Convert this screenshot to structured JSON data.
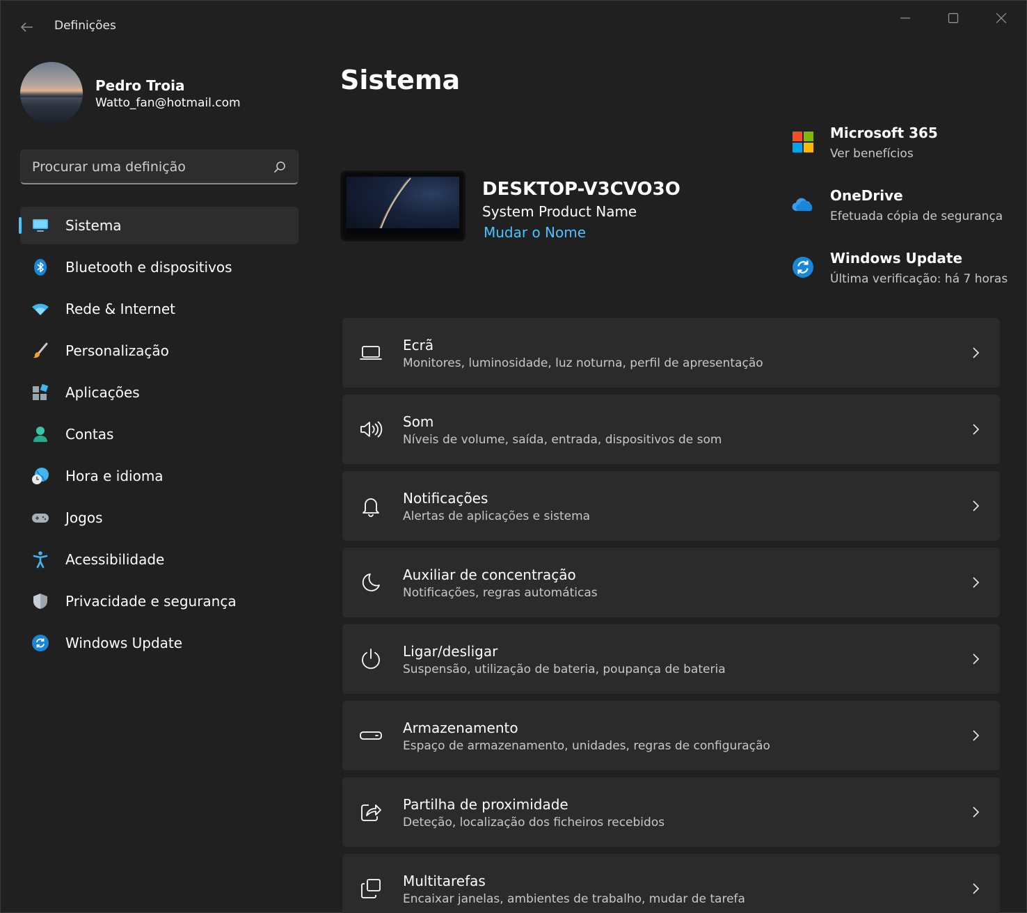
{
  "window": {
    "title": "Definições"
  },
  "profile": {
    "name": "Pedro Troia",
    "email": "Watto_fan@hotmail.com"
  },
  "search": {
    "placeholder": "Procurar uma definição"
  },
  "sidebar": {
    "items": [
      {
        "label": "Sistema",
        "icon": "monitor-icon",
        "active": true
      },
      {
        "label": "Bluetooth e dispositivos",
        "icon": "bluetooth-icon"
      },
      {
        "label": "Rede & Internet",
        "icon": "wifi-icon"
      },
      {
        "label": "Personalização",
        "icon": "brush-icon"
      },
      {
        "label": "Aplicações",
        "icon": "apps-icon"
      },
      {
        "label": "Contas",
        "icon": "person-icon"
      },
      {
        "label": "Hora e idioma",
        "icon": "globe-clock-icon"
      },
      {
        "label": "Jogos",
        "icon": "gamepad-icon"
      },
      {
        "label": "Acessibilidade",
        "icon": "accessibility-icon"
      },
      {
        "label": "Privacidade e segurança",
        "icon": "shield-icon"
      },
      {
        "label": "Windows Update",
        "icon": "update-icon"
      }
    ]
  },
  "main": {
    "title": "Sistema",
    "device": {
      "name": "DESKTOP-V3CVO3O",
      "model": "System Product Name",
      "rename_link": "Mudar o Nome"
    },
    "quick_links": [
      {
        "title": "Microsoft 365",
        "subtitle": "Ver benefícios",
        "icon": "microsoft-logo-icon"
      },
      {
        "title": "OneDrive",
        "subtitle": "Efetuada cópia de segurança",
        "icon": "onedrive-cloud-icon"
      },
      {
        "title": "Windows Update",
        "subtitle": "Última verificação: há 7 horas",
        "icon": "update-icon"
      }
    ],
    "cards": [
      {
        "title": "Ecrã",
        "subtitle": "Monitores, luminosidade, luz noturna, perfil de apresentação",
        "icon": "laptop-icon"
      },
      {
        "title": "Som",
        "subtitle": "Níveis de volume, saída, entrada, dispositivos de som",
        "icon": "speaker-icon"
      },
      {
        "title": "Notificações",
        "subtitle": "Alertas de aplicações e sistema",
        "icon": "bell-icon"
      },
      {
        "title": "Auxiliar de concentração",
        "subtitle": "Notificações, regras automáticas",
        "icon": "moon-icon"
      },
      {
        "title": "Ligar/desligar",
        "subtitle": "Suspensão, utilização de bateria, poupança de bateria",
        "icon": "power-icon"
      },
      {
        "title": "Armazenamento",
        "subtitle": "Espaço de armazenamento, unidades, regras de configuração",
        "icon": "storage-icon"
      },
      {
        "title": "Partilha de proximidade",
        "subtitle": "Deteção, localização dos ficheiros recebidos",
        "icon": "share-icon"
      },
      {
        "title": "Multitarefas",
        "subtitle": "Encaixar janelas, ambientes de trabalho, mudar de tarefa",
        "icon": "multitask-icon"
      }
    ]
  },
  "colors": {
    "accent": "#4cc2ff",
    "background": "#202020",
    "card": "#2b2b2b"
  }
}
